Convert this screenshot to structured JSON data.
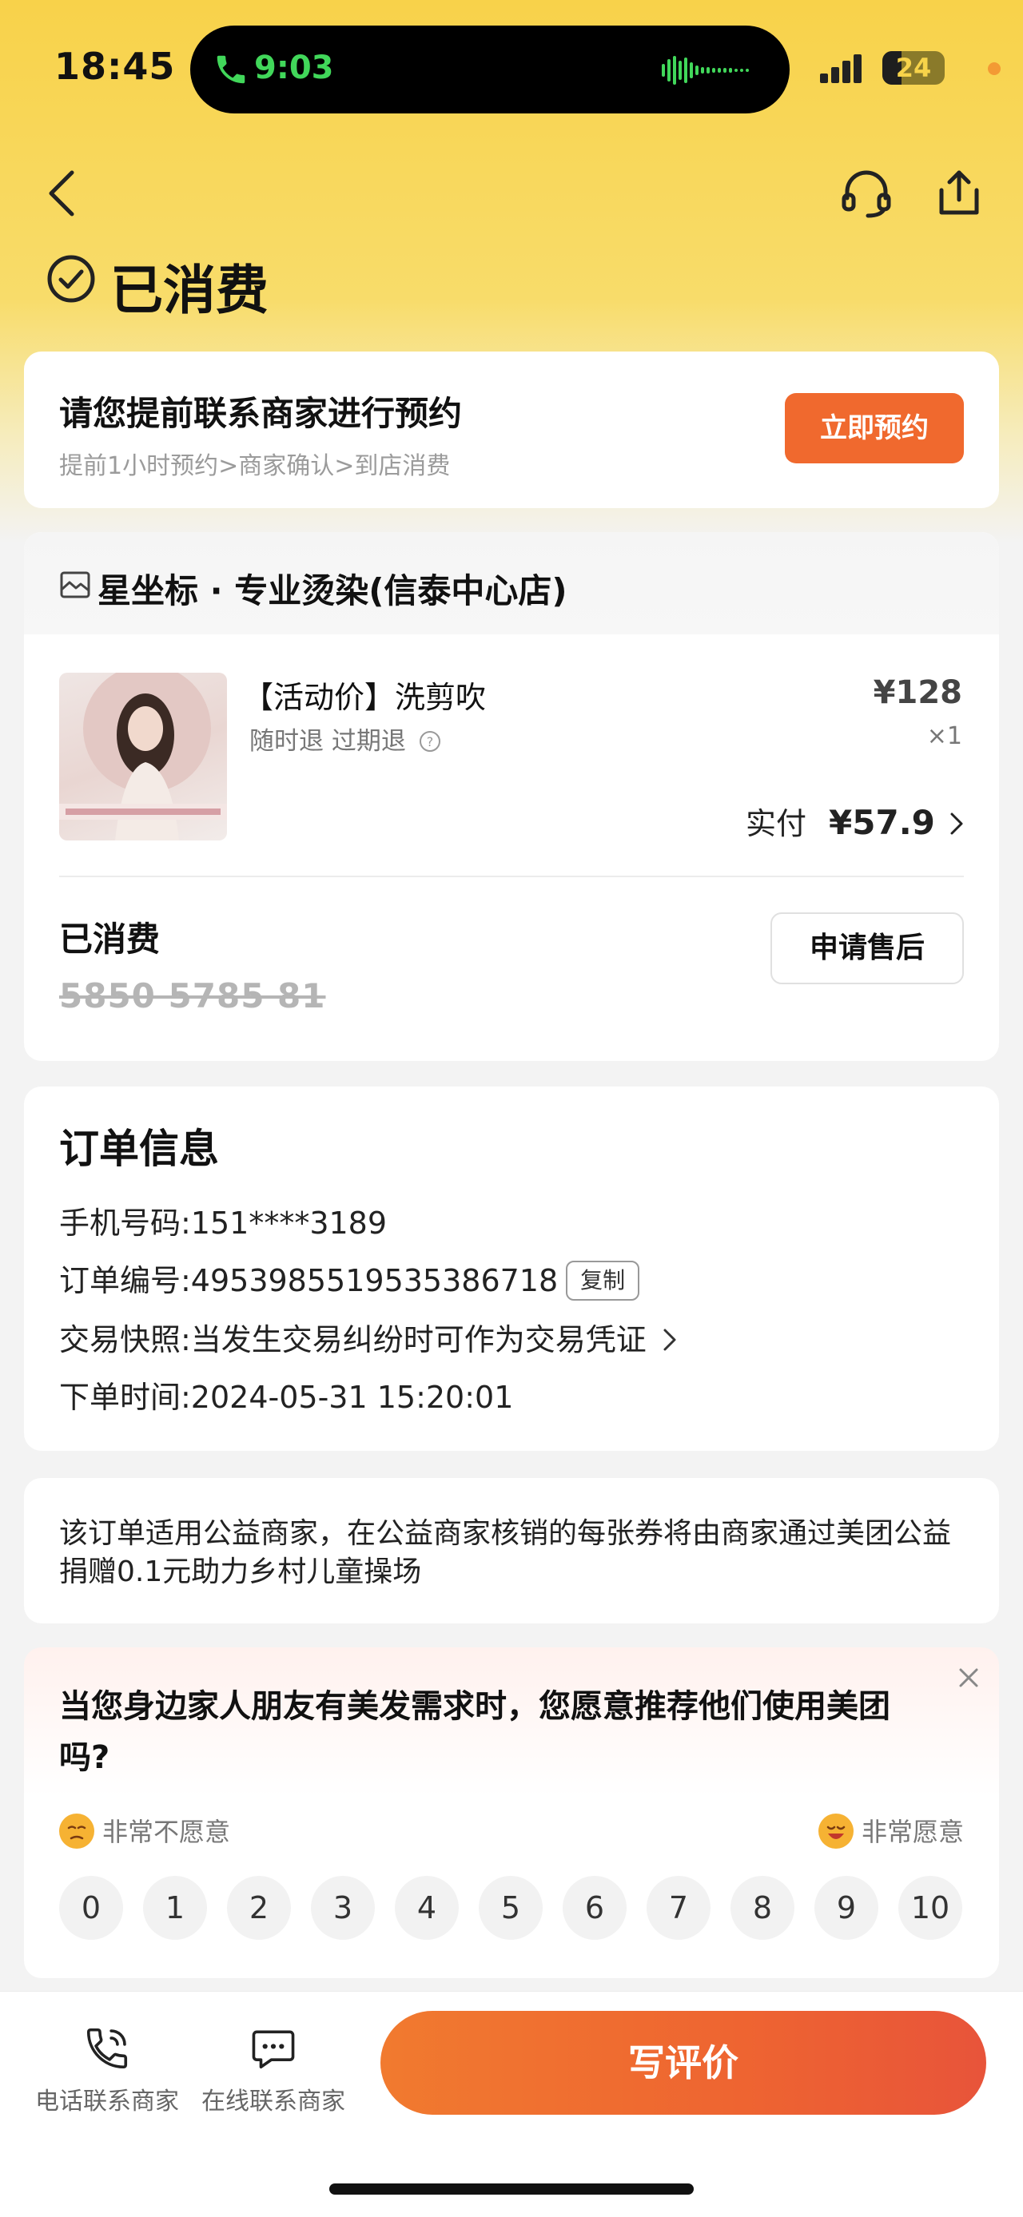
{
  "status_bar": {
    "time": "18:45",
    "call_time": "9:03",
    "battery": "24"
  },
  "header": {
    "title": "已消费",
    "icons": [
      "back-icon",
      "headset-icon",
      "share-icon",
      "check-circle-icon"
    ]
  },
  "booking": {
    "title": "请您提前联系商家进行预约",
    "steps": "提前1小时预约>商家确认>到店消费",
    "button": "立即预约"
  },
  "shop": {
    "name": "星坐标 · 专业烫染(信泰中心店)",
    "product": {
      "name": "【活动价】洗剪吹",
      "tags": "随时退 过期退",
      "price": "¥128",
      "qty": "×1",
      "paid_label": "实付",
      "paid_amount": "¥57.9"
    },
    "status": "已消费",
    "code": "5850 5785 81",
    "after_sale_button": "申请售后"
  },
  "order": {
    "heading": "订单信息",
    "phone": "手机号码:151****3189",
    "number": "订单编号:4953985519535386718",
    "copy_button": "复制",
    "snapshot": "交易快照:当发生交易纠纷时可作为交易凭证",
    "time": "下单时间:2024-05-31 15:20:01"
  },
  "charity": {
    "text": "该订单适用公益商家，在公益商家核销的每张券将由商家通过美团公益捐赠0.1元助力乡村儿童操场"
  },
  "survey": {
    "question": "当您身边家人朋友有美发需求时，您愿意推荐他们使用美团吗?",
    "low_label": "非常不愿意",
    "high_label": "非常愿意",
    "scores": [
      "0",
      "1",
      "2",
      "3",
      "4",
      "5",
      "6",
      "7",
      "8",
      "9",
      "10"
    ]
  },
  "bottom_bar": {
    "phone_contact": "电话联系商家",
    "online_contact": "在线联系商家",
    "review_button": "写评价"
  },
  "colors": {
    "accent": "#f0692e",
    "header_yellow": "#f8d24a",
    "call_green": "#41d75a"
  }
}
